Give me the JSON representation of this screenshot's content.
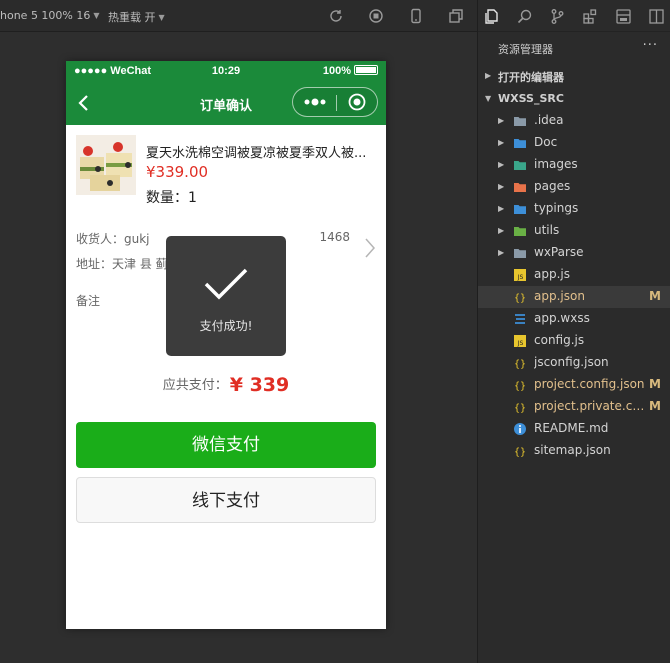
{
  "toolbar": {
    "device": "hone 5 100% 16",
    "hot_reload": "热重载 开",
    "icons": [
      "refresh-icon",
      "stop-icon",
      "phone-icon",
      "window-icon"
    ]
  },
  "phone": {
    "status": {
      "carrier": "●●●●● WeChat",
      "time": "10:29",
      "battery": "100%"
    },
    "nav": {
      "title": "订单确认"
    },
    "product": {
      "title": "夏天水洗棉空调被夏凉被夏季双人被...",
      "price": "¥339.00",
      "qty": "数量：1"
    },
    "address": {
      "receiver": "收货人：gukj",
      "phone": "1468",
      "addr": "地址：天津 县 蓟"
    },
    "note": "备注",
    "toast": {
      "text": "支付成功!"
    },
    "total": {
      "label": "应共支付：",
      "amount": "¥ 339"
    },
    "buttons": {
      "wechat_pay": "微信支付",
      "offline_pay": "线下支付"
    }
  },
  "explorer": {
    "tab_icons": [
      "files-icon",
      "search-icon",
      "source-control-icon",
      "extensions-icon",
      "debug-icon",
      "more-icon"
    ],
    "title": "资源管理器",
    "more": "···",
    "open_editors": "打开的编辑器",
    "root": "WXSS_SRC",
    "items": [
      {
        "name": ".idea",
        "type": "folder",
        "color": "#8a9aa8",
        "badge": ""
      },
      {
        "name": "Doc",
        "type": "folder",
        "color": "#3d8fd8",
        "badge": ""
      },
      {
        "name": "images",
        "type": "folder",
        "color": "#3aa68a",
        "badge": ""
      },
      {
        "name": "pages",
        "type": "folder",
        "color": "#e8734a",
        "badge": ""
      },
      {
        "name": "typings",
        "type": "folder",
        "color": "#3d8fd8",
        "badge": ""
      },
      {
        "name": "utils",
        "type": "folder",
        "color": "#69b045",
        "badge": ""
      },
      {
        "name": "wxParse",
        "type": "folder",
        "color": "#8a9aa8",
        "badge": ""
      },
      {
        "name": "app.js",
        "type": "js",
        "color": "#e8c62e",
        "badge": ""
      },
      {
        "name": "app.json",
        "type": "json",
        "color": "#e8c62e",
        "badge": "M"
      },
      {
        "name": "app.wxss",
        "type": "css",
        "color": "#3d8fd8",
        "badge": ""
      },
      {
        "name": "config.js",
        "type": "js",
        "color": "#e8c62e",
        "badge": ""
      },
      {
        "name": "jsconfig.json",
        "type": "json",
        "color": "#e8c62e",
        "badge": ""
      },
      {
        "name": "project.config.json",
        "type": "json",
        "color": "#e8c62e",
        "badge": "M"
      },
      {
        "name": "project.private.co...",
        "type": "json",
        "color": "#e8c62e",
        "badge": "M"
      },
      {
        "name": "README.md",
        "type": "info",
        "color": "#3d8fd8",
        "badge": ""
      },
      {
        "name": "sitemap.json",
        "type": "json",
        "color": "#e8c62e",
        "badge": ""
      }
    ]
  },
  "colors": {
    "wechat_green": "#1b8a3a",
    "pay_button": "#1aad19",
    "price_red": "#e02e24",
    "modified": "#e2c08d"
  }
}
